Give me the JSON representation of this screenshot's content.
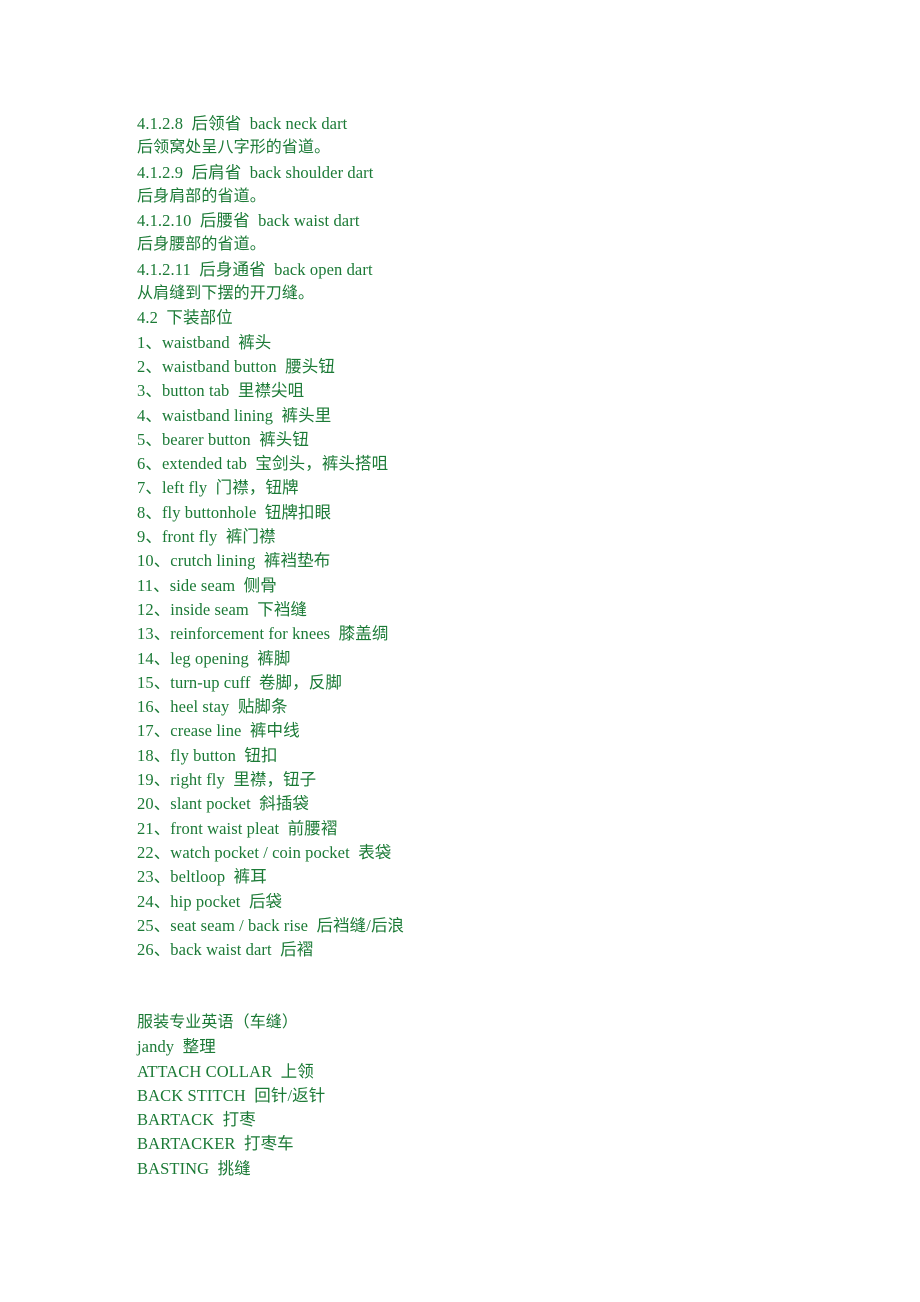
{
  "document": {
    "text_color": "#1b7a36",
    "background_color": "#ffffff",
    "sections": [
      {
        "name": "upper-garment-darts",
        "lines": [
          "4.1.2.8  后领省  back neck dart",
          "后领窝处呈八字形的省道。",
          "4.1.2.9  后肩省  back shoulder dart",
          "后身肩部的省道。",
          "4.1.2.10  后腰省  back waist dart",
          "后身腰部的省道。",
          "4.1.2.11  后身通省  back open dart",
          "从肩缝到下摆的开刀缝。"
        ]
      },
      {
        "name": "lower-garment-parts",
        "heading": "4.2  下装部位",
        "lines": [
          "1、waistband  裤头",
          "2、waistband button  腰头钮",
          "3、button tab  里襟尖咀",
          "4、waistband lining  裤头里",
          "5、bearer button  裤头钮",
          "6、extended tab  宝剑头，裤头搭咀",
          "7、left fly  门襟，钮牌",
          "8、fly buttonhole  钮牌扣眼",
          "9、front fly  裤门襟",
          "10、crutch lining  裤裆垫布",
          "11、side seam  侧骨",
          "12、inside seam  下裆缝",
          "13、reinforcement for knees  膝盖绸",
          "14、leg opening  裤脚",
          "15、turn-up cuff  卷脚，反脚",
          "16、heel stay  贴脚条",
          "17、crease line  裤中线",
          "18、fly button  钮扣",
          "19、right fly  里襟，钮子",
          "20、slant pocket  斜插袋",
          "21、front waist pleat  前腰褶",
          "22、watch pocket / coin pocket  表袋",
          "23、beltloop  裤耳",
          "24、hip pocket  后袋",
          "25、seat seam / back rise  后裆缝/后浪",
          "26、back waist dart  后褶"
        ]
      },
      {
        "name": "sewing-english-glossary",
        "heading": "服装专业英语（车缝）",
        "byline": "jandy  整理",
        "lines": [
          "ATTACH COLLAR  上领",
          "BACK STITCH  回针/返针",
          "BARTACK  打枣",
          "BARTACKER  打枣车",
          "BASTING  挑缝"
        ]
      }
    ]
  }
}
